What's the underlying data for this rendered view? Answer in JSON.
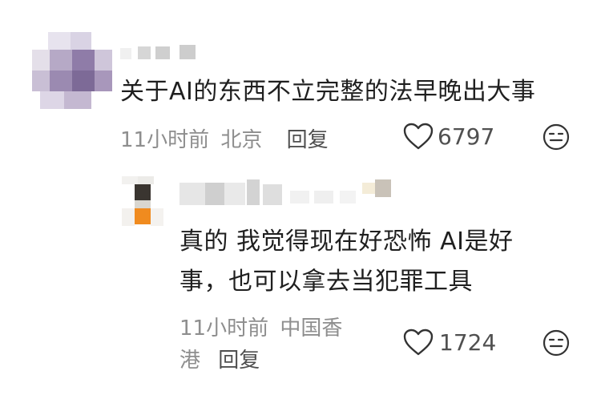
{
  "comments": [
    {
      "text": "关于AI的东西不立完整的法早晚出大事",
      "time": "11小时前",
      "location": "北京",
      "reply_label": "回复",
      "likes": "6797"
    }
  ],
  "reply": {
    "text_line1": "真的 我觉得现在好恐怖 AI是好",
    "text_line2": "事，也可以拿去当犯罪工具",
    "time": "11小时前",
    "location": "中国香",
    "location_cont": "港",
    "reply_label": "回复",
    "likes": "1724"
  },
  "icons": {
    "like": "heart-outline-icon",
    "emoji": "emoji-face-icon"
  },
  "colors": {
    "meta": "#8e8e8e",
    "text": "#1f1f1f"
  }
}
